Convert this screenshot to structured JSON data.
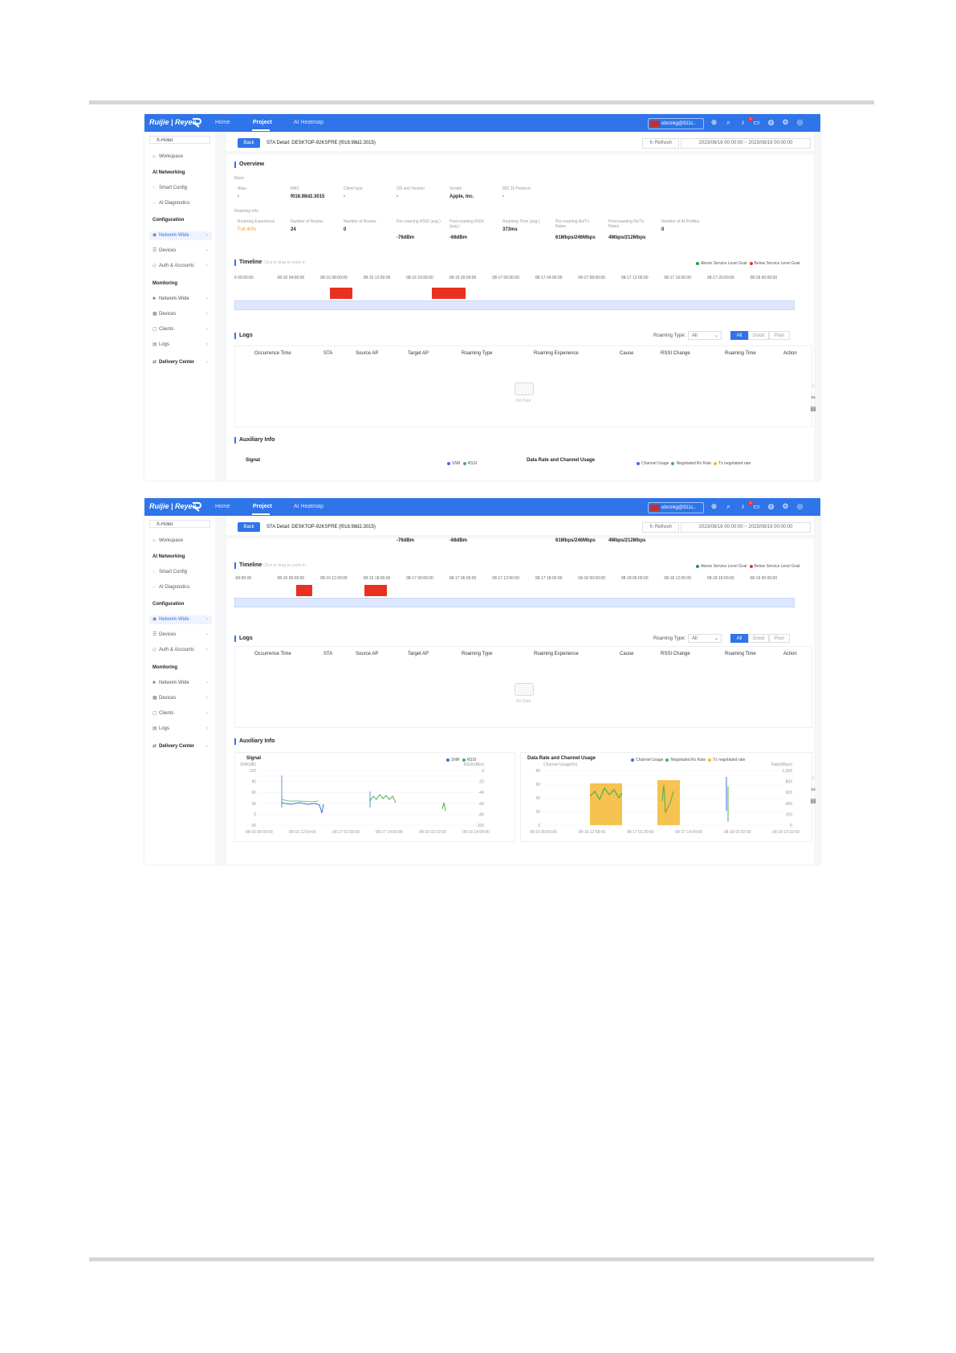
{
  "top_bar": {
    "brand": "Ruijie | Reyee",
    "nav": [
      "Home",
      "Project",
      "AI Heatmap"
    ],
    "active_nav": "Project",
    "user": "ebcmkg@911c..",
    "notification_count": "1"
  },
  "sidebar": {
    "site": "X-Hotel",
    "workspace": "Workspace",
    "sections": {
      "ai_networking": "AI Networking",
      "configuration": "Configuration",
      "monitoring": "Monitoring"
    },
    "items": {
      "smart_config": "Smart Config",
      "ai_diagnostics": "AI Diagnostics",
      "network_wide": "Network-Wide",
      "devices": "Devices",
      "auth_accounts": "Auth & Accounts",
      "mon_network_wide": "Network-Wide",
      "mon_devices": "Devices",
      "clients": "Clients",
      "logs": "Logs",
      "delivery_center": "Delivery Center"
    }
  },
  "header": {
    "back": "Back",
    "sta_detail": "STA Detail:  DESKTOP-92KSFRE  (f018.98d2.3015)",
    "refresh": "Refresh",
    "date_range": "2023/08/16 00:00:00  ~  2023/08/19 00:00:00"
  },
  "overview": {
    "title": "Overview",
    "basic_label": "Basic",
    "basic": [
      {
        "label": "Alias",
        "value": "-"
      },
      {
        "label": "MAC",
        "value": "f018.98d2.3015"
      },
      {
        "label": "Client type",
        "value": "-"
      },
      {
        "label": "OS and Version",
        "value": "-"
      },
      {
        "label": "Vendor",
        "value": "Apple, Inc."
      },
      {
        "label": "802.11 Protocol",
        "value": "-"
      }
    ],
    "roaming_label": "Roaming Info",
    "roaming": [
      {
        "label": "Roaming Experience",
        "value": "Full 40%"
      },
      {
        "label": "Number of Roams",
        "value": "24"
      },
      {
        "label": "Number of Roams",
        "value": "0"
      },
      {
        "label": "Pre-roaming RSSI (avg.)",
        "value": "-76dBm"
      },
      {
        "label": "Post-roaming RSSI (avg.)",
        "value": "-68dBm"
      },
      {
        "label": "Roaming Time (avg.)",
        "value": "373ms"
      },
      {
        "label": "Pre-roaming Rx/Tx Rates",
        "value": "61Mbps/246Mbps"
      },
      {
        "label": "Post-roaming Rx/Tx Rates",
        "value": "4Mbps/212Mbps"
      },
      {
        "label": "Number of AI Profiles",
        "value": "0"
      }
    ]
  },
  "timeline": {
    "title": "Timeline",
    "hint": "Click or drag to zoom in",
    "legend_above": "Above Service Level Goal",
    "legend_below": "Below Service Level Goal",
    "color_above": "#1aa13f",
    "color_below": "#e8321f",
    "ticks_1": [
      "6 00:00:00",
      "08-16 04:00:00",
      "08-16 08:00:00",
      "08-16 12:00:00",
      "08-16 16:00:00",
      "08-16 20:00:00",
      "08-17 00:00:00",
      "08-17 04:00:00",
      "08-17 08:00:00",
      "08-17 12:00:00",
      "08-17 16:00:00",
      "08-17 20:00:00",
      "08-18 00:00:00"
    ],
    "ticks_2": [
      "-00:00:00",
      "08-16 00:00:00",
      "08-16 12:00:00",
      "08-16 18:00:00",
      "08-17 00:00:00",
      "08-17 06:00:00",
      "08-17 12:00:00",
      "08-17 18:00:00",
      "08-18 00:00:00",
      "08-18 06:00:00",
      "08-18 12:00:00",
      "08-18 18:00:00",
      "08-19 00:00:00"
    ]
  },
  "logs": {
    "title": "Logs",
    "roaming_type_label": "Roaming Type:",
    "roaming_type_value": "All",
    "segments": [
      "All",
      "Good",
      "Poor"
    ],
    "columns": [
      "Occurrence Time",
      "STA",
      "Source AP",
      "Target AP",
      "Roaming Type",
      "Roaming Experience",
      "Cause",
      "RSSI Change",
      "Roaming Time",
      "Action"
    ],
    "empty": "No Data"
  },
  "auxiliary": {
    "title": "Auxiliary Info",
    "signal": {
      "title": "Signal",
      "legend": [
        "SNR",
        "RSSI"
      ],
      "left_unit": "SNR(dB)",
      "right_unit": "RSSI(dBm)",
      "left_ticks": [
        "120",
        "90",
        "60",
        "30",
        "0",
        "-30"
      ],
      "right_ticks": [
        "0",
        "-20",
        "-40",
        "-60",
        "-80",
        "-100"
      ],
      "x_ticks": [
        "08-16 00:00:00",
        "08-16 12:54:00",
        "08-17 01:50:00",
        "08-17 14:56:00",
        "08-18 02:22:00",
        "08-18 14:58:00"
      ]
    },
    "rate": {
      "title": "Data Rate and Channel Usage",
      "legend": [
        "Channel Usage",
        "Negotiated Rx Rate",
        "Tx negotiated rate"
      ],
      "left_unit": "Channel Usage(%)",
      "right_unit": "Rate(Mbps)",
      "left_ticks": [
        "80",
        "60",
        "40",
        "20",
        "0"
      ],
      "right_ticks": [
        "1,000",
        "800",
        "600",
        "400",
        "200",
        "0"
      ],
      "x_ticks": [
        "08-16 00:00:00",
        "08-16 12:58:00",
        "08-17 01:30:00",
        "08-17 14:54:00",
        "08-18 02:32:00",
        "08-18 13:32:00"
      ]
    }
  },
  "colors": {
    "accent": "#2f74e8",
    "snr": "#3b6fd6",
    "rssi": "#4caf50",
    "channel_usage": "#f5b731"
  }
}
